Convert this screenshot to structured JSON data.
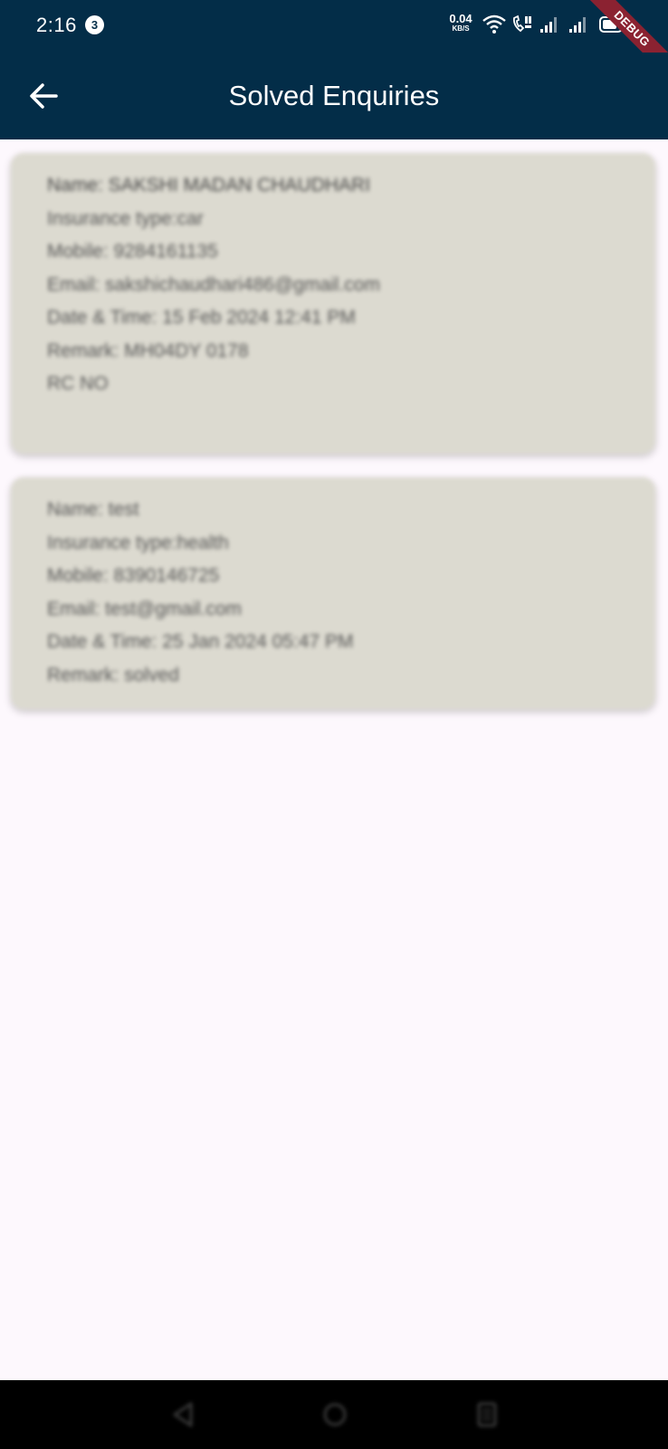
{
  "status_bar": {
    "time": "2:16",
    "notification_count": "3",
    "net_speed": "0.04",
    "net_speed_unit": "KB/S",
    "icons": [
      "wifi-icon",
      "volte-call-icon",
      "signal-sim1-icon",
      "signal-sim2-icon",
      "battery-icon"
    ]
  },
  "debug_banner": "DEBUG",
  "app_bar": {
    "title": "Solved Enquiries",
    "back_icon": "arrow-back-icon"
  },
  "enquiries": [
    {
      "name": "Name: SAKSHI MADAN CHAUDHARI",
      "insurance_type": "Insurance type:car",
      "mobile": "Mobile: 9284161135",
      "email": "Email: sakshichaudhari486@gmail.com",
      "date_time": "Date & Time: 15 Feb 2024 12:41 PM",
      "remark": "Remark: MH04DY 0178",
      "remark_extra": "RC NO"
    },
    {
      "name": "Name: test",
      "insurance_type": "Insurance type:health",
      "mobile": "Mobile: 8390146725",
      "email": "Email: test@gmail.com",
      "date_time": "Date & Time: 25 Jan 2024 05:47 PM",
      "remark": "Remark: solved"
    }
  ],
  "nav_bar": {
    "buttons": [
      "back-nav-icon",
      "home-nav-icon",
      "recents-nav-icon"
    ]
  },
  "colors": {
    "app_bar": "#032d48",
    "card_background": "#dcdad0",
    "page_background": "#fdf8fd",
    "debug_ribbon": "#8b2231"
  }
}
